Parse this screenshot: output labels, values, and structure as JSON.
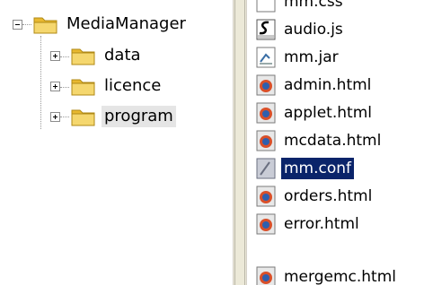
{
  "tree": {
    "root": {
      "label": "MediaManager",
      "expanded": true
    },
    "children": [
      {
        "label": "data",
        "expanded": false
      },
      {
        "label": "licence",
        "expanded": false
      },
      {
        "label": "program",
        "expanded": false,
        "selected": true
      }
    ]
  },
  "files": [
    {
      "name": "mm.css",
      "icon": "css-file-icon",
      "partial": true
    },
    {
      "name": "audio.js",
      "icon": "script-file-icon"
    },
    {
      "name": "mm.jar",
      "icon": "jar-file-icon"
    },
    {
      "name": "admin.html",
      "icon": "html-file-icon"
    },
    {
      "name": "applet.html",
      "icon": "html-file-icon"
    },
    {
      "name": "mcdata.html",
      "icon": "html-file-icon"
    },
    {
      "name": "mm.conf",
      "icon": "config-file-icon",
      "selected": true
    },
    {
      "name": "orders.html",
      "icon": "html-file-icon"
    },
    {
      "name": "error.html",
      "icon": "html-file-icon"
    },
    {
      "name": "mergemc.html",
      "icon": "html-file-icon",
      "partial": true
    }
  ],
  "colors": {
    "folder": "#f5d76e",
    "selection_active": "#0a246a",
    "selection_inactive": "#e5e5e5",
    "splitter": "#ece9d8"
  }
}
